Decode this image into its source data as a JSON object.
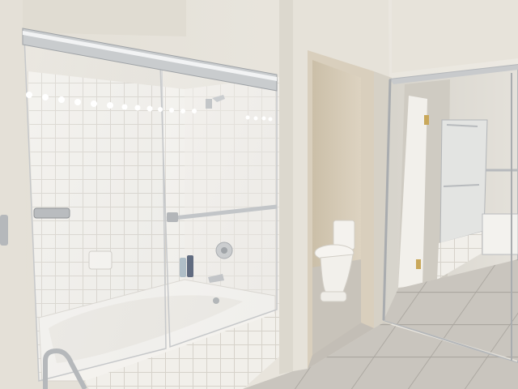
{
  "scene": {
    "description_hidden": "",
    "colors": {
      "wall": "#e7e3da",
      "wall_shadow": "#cfc9bd",
      "ceiling": "#d9d4c8",
      "tile": "#f1efea",
      "tile_grout": "#d6d2ca",
      "floor_tile": "#c9c5be",
      "floor_grout": "#a9a59e",
      "chrome": "#b9bcbf",
      "door": "#f3f1ec",
      "toilet_room_wall": "#d8cdb8",
      "mirror_tint": "#dcdad4",
      "light": "#ffffff"
    },
    "icons": [
      "vanity-light-icon",
      "shower-head-icon",
      "toilet-icon",
      "towel-bar-icon",
      "grab-bar-icon",
      "soap-dish-icon",
      "shampoo-bottle-icon"
    ]
  }
}
